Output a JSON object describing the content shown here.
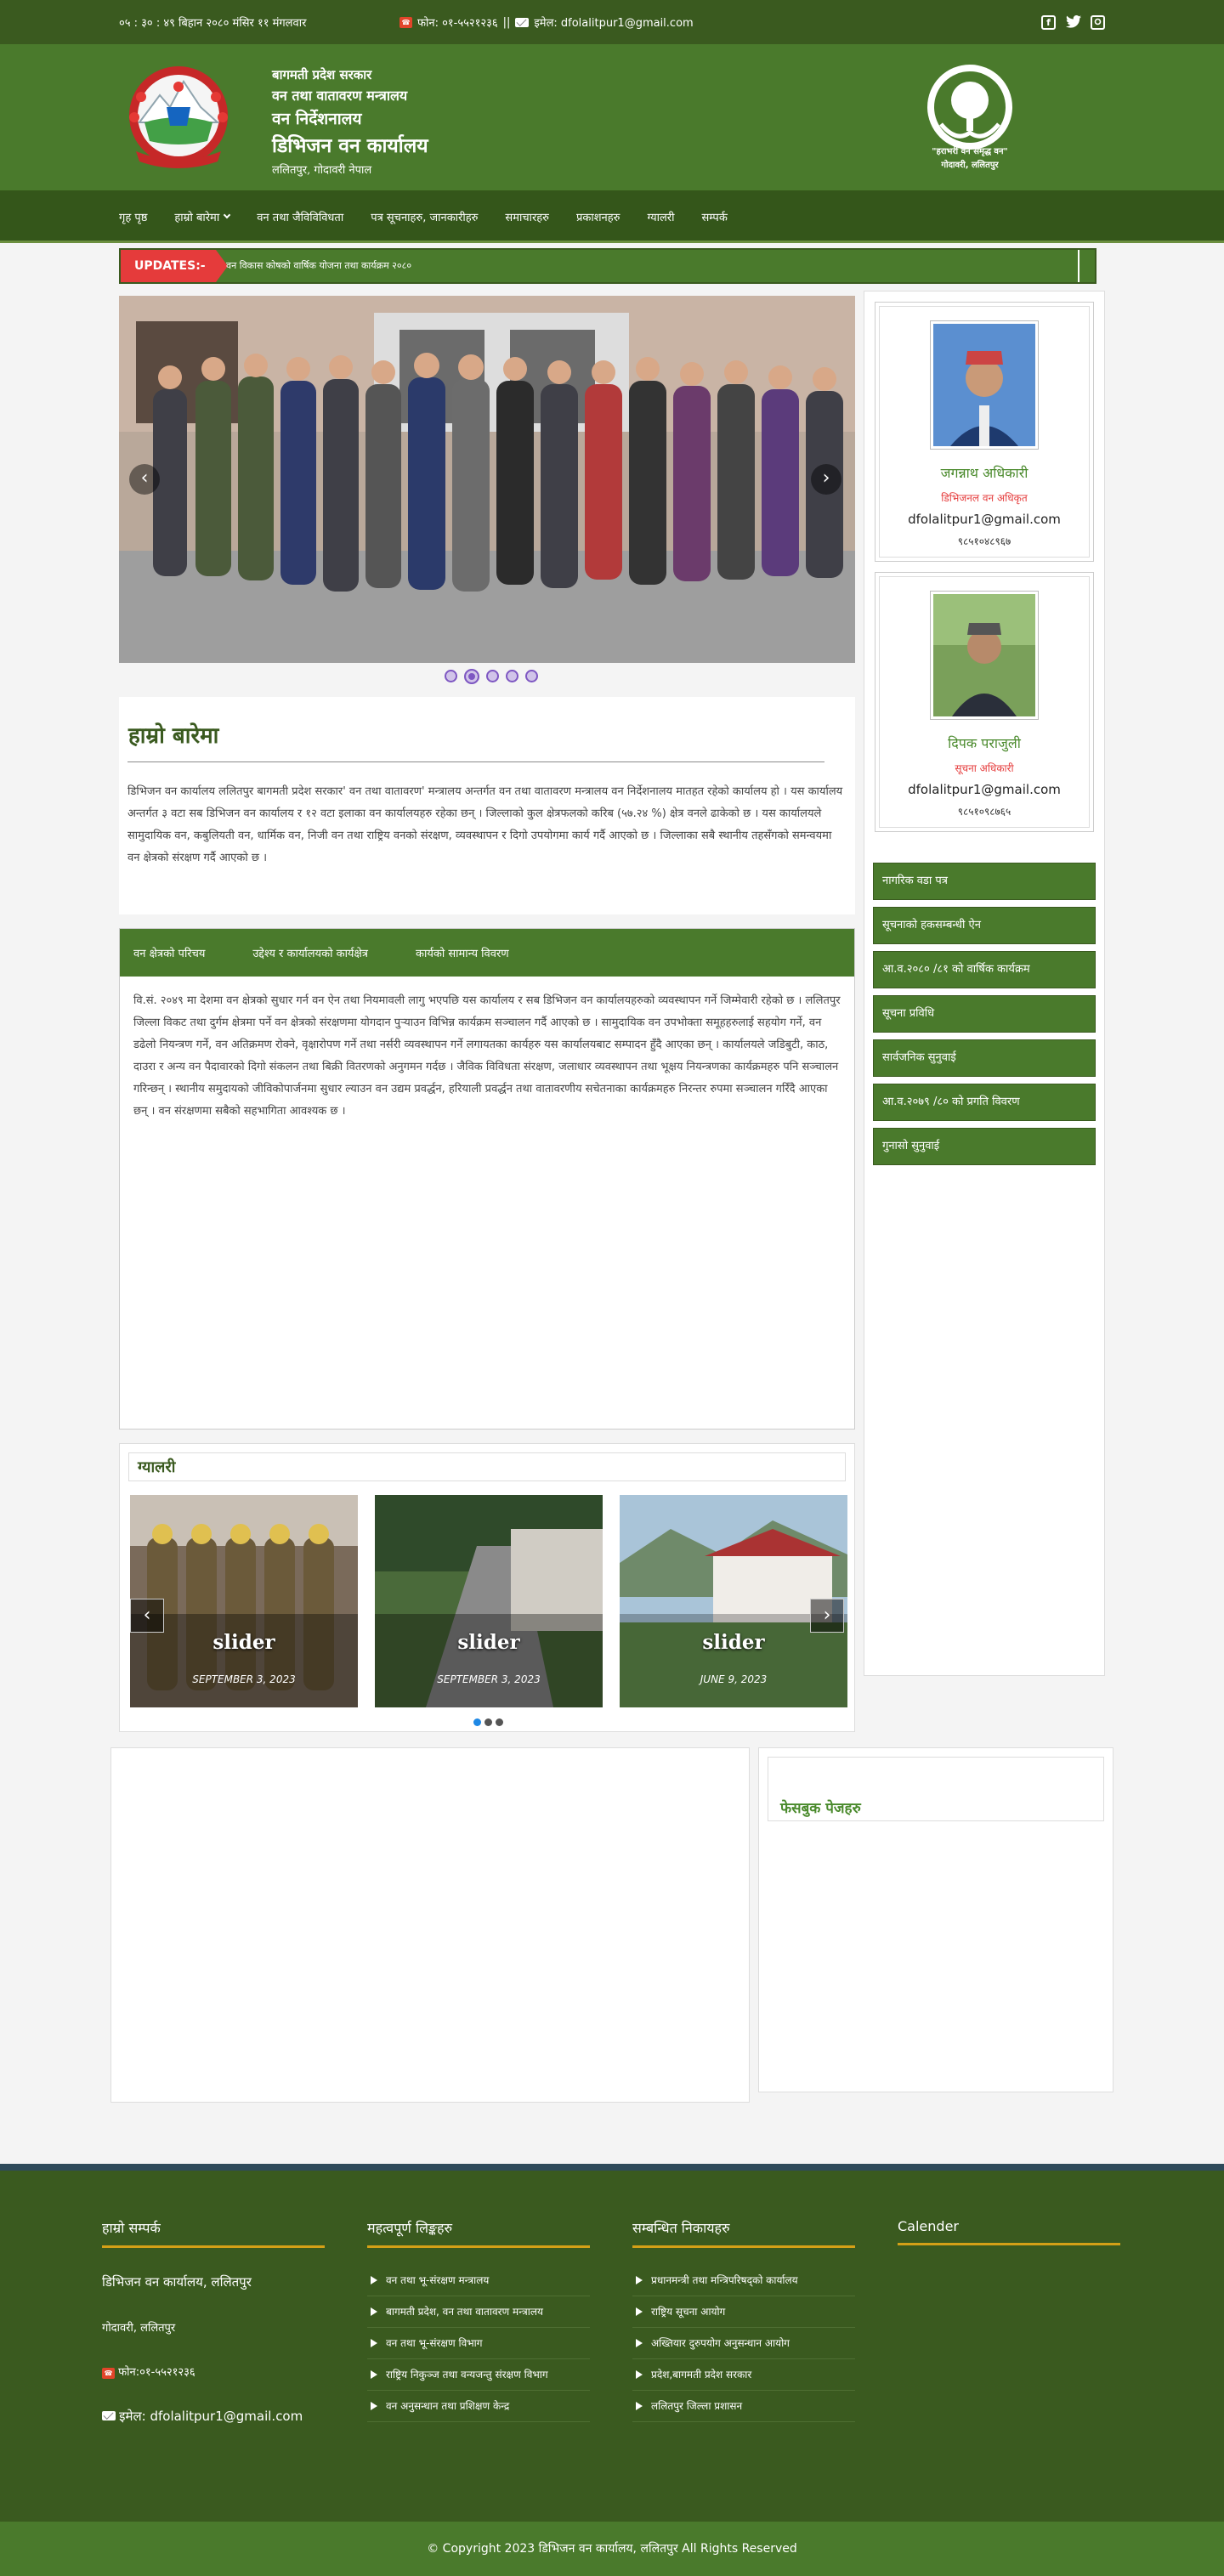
{
  "topbar": {
    "date": "०५ : ३० : ४९ बिहान   २०८० मंसिर ११ मंगलवार",
    "phone_label": "फोन: ०१-५५२१२३६",
    "separator": "||",
    "email_label": "इमेल: dfolalitpur1@gmail.com",
    "social": [
      "facebook-icon",
      "twitter-icon",
      "instagram-icon"
    ]
  },
  "header": {
    "line1": "बागमती प्रदेश सरकार",
    "line2": "वन तथा वातावरण मन्त्रालय",
    "line3": "वन निर्देशनालय",
    "line4": "डिभिजन वन कार्यालय",
    "line5": "ललितपुर, गोदावरी नेपाल",
    "right_logo_text": "\"हराभरी वन समृद्ध वन\"",
    "right_logo_sub": "गोदावरी, ललितपुर"
  },
  "nav": [
    "गृह पृष्ठ",
    "हाम्रो बारेमा",
    "वन तथा जैविविविधता",
    "पत्र सूचनाहरु, जानकारीहरु",
    "समाचारहरु",
    "प्रकाशनहरु",
    "ग्यालरी",
    "सम्पर्क"
  ],
  "updates": {
    "tag": "UPDATES:-",
    "text": "वन विकास कोषको वार्षिक योजना तथा कार्यक्रम २०८०"
  },
  "intro": {
    "title": "हाम्रो बारेमा",
    "body": "डिभिजन वन कार्यालय ललितपुर बागमती प्रदेश सरकार' वन तथा वातावरण' मन्त्रालय अन्तर्गत वन तथा वातावरण मन्त्रालय वन निर्देशनालय मातहत रहेको कार्यालय हो । यस कार्यालय अन्तर्गत ३ वटा सब डिभिजन वन कार्यालय र १२ वटा इलाका वन कार्यालयहरु रहेका छन् । जिल्लाको कुल क्षेत्रफलको करिब (५७.२४ %) क्षेत्र वनले ढाकेको छ । यस कार्यालयले सामुदायिक वन, कबुलियती वन, धार्मिक वन, निजी वन तथा राष्ट्रिय वनको संरक्षण, व्यवस्थापन र दिगो उपयोगमा कार्य गर्दै आएको छ । जिल्लाका सबै स्थानीय तहसँगको समन्वयमा वन क्षेत्रको संरक्षण गर्दै आएको छ ।"
  },
  "tabs": {
    "labels": [
      "वन क्षेत्रको परिचय",
      "उद्देश्य र कार्यालयको कार्यक्षेत्र",
      "कार्यको सामान्य विवरण"
    ],
    "body": "वि.सं. २०४९ मा देशमा वन क्षेत्रको सुधार गर्न वन ऐन तथा नियमावली लागु भएपछि यस कार्यालय र सब डिभिजन वन कार्यालयहरुको व्यवस्थापन गर्ने जिम्मेवारी रहेको छ । ललितपुर जिल्ला विकट तथा दुर्गम क्षेत्रमा पर्ने वन क्षेत्रको संरक्षणमा योगदान पुर्‍याउन विभिन्न कार्यक्रम सञ्चालन गर्दै आएको छ । सामुदायिक वन उपभोक्ता समूहहरुलाई सहयोग गर्ने, वन डढेलो नियन्त्रण गर्ने, वन अतिक्रमण रोक्ने, वृक्षारोपण गर्ने तथा नर्सरी व्यवस्थापन गर्ने लगायतका कार्यहरु यस कार्यालयबाट सम्पादन हुँदै आएका छन् । कार्यालयले जडिबुटी, काठ, दाउरा र अन्य वन पैदावारको दिगो संकलन तथा बिक्री वितरणको अनुगमन गर्दछ । जैविक विविधता संरक्षण, जलाधार व्यवस्थापन तथा भूक्षय नियन्त्रणका कार्यक्रमहरु पनि सञ्चालन गरिन्छन् । स्थानीय समुदायको जीविकोपार्जनमा सुधार ल्याउन वन उद्यम प्रवर्द्धन, हरियाली प्रवर्द्धन तथा वातावरणीय सचेतनाका कार्यक्रमहरु निरन्तर रुपमा सञ्चालन गरिँदै आएका छन् । वन संरक्षणमा सबैको सहभागिता आवश्यक छ ।"
  },
  "gallery": {
    "title": "ग्यालरी",
    "items": [
      {
        "caption": "slider",
        "date": "SEPTEMBER 3, 2023"
      },
      {
        "caption": "slider",
        "date": "SEPTEMBER 3, 2023"
      },
      {
        "caption": "slider",
        "date": "JUNE 9, 2023"
      }
    ]
  },
  "sidebar": {
    "officials": [
      {
        "name": "जगन्नाथ अधिकारी",
        "role": "डिभिजनल वन अधिकृत",
        "email": "dfolalitpur1@gmail.com",
        "phone": "९८५१०४८९६७"
      },
      {
        "name": "दिपक पराजुली",
        "role": "सूचना अधिकारी",
        "email": "dfolalitpur1@gmail.com",
        "phone": "९८५१०९८७६५"
      }
    ],
    "links": [
      "नागरिक वडा पत्र",
      "सूचनाको हकसम्बन्धी ऐन",
      "आ.व.२०८० /८१ को वार्षिक कार्यक्रम",
      "सूचना प्रविधि",
      "सार्वजनिक सुनुवाई",
      "आ.व.२०७९ /८० को प्रगति विवरण",
      "गुनासो सुनुवाई"
    ]
  },
  "lower": {
    "right_title": "फेसबुक पेजहरु"
  },
  "footer": {
    "col1_title": "हाम्रो सम्पर्क",
    "office": "डिभिजन वन कार्यालय, ललितपुर",
    "address": "गोदावरी, ललितपुर",
    "phone": "फोन:०१-५५२१२३६",
    "email": "इमेल: dfolalitpur1@gmail.com",
    "col2_title": "महत्वपूर्ण लिङ्कहरु",
    "col2_links": [
      "वन तथा भू-संरक्षण मन्त्रालय",
      "बागमती प्रदेश, वन तथा वातावरण मन्त्रालय",
      "वन तथा भू-संरक्षण विभाग",
      "राष्ट्रिय निकुञ्ज तथा वन्यजन्तु संरक्षण विभाग",
      "वन अनुसन्धान तथा प्रशिक्षण केन्द्र"
    ],
    "col3_title": "सम्बन्धित निकायहरु",
    "col3_links": [
      "प्रधानमन्त्री तथा मन्त्रिपरिषद्को कार्यालय",
      "राष्ट्रिय सूचना आयोग",
      "अख्तियार दुरुपयोग अनुसन्धान आयोग",
      "प्रदेश,बागमती प्रदेश सरकार",
      "ललितपुर जिल्ला प्रशासन"
    ],
    "col4_title": "Calender",
    "copyright": "© Copyright 2023 डिभिजन वन कार्यालय, ललितपुर All Rights Reserved"
  }
}
